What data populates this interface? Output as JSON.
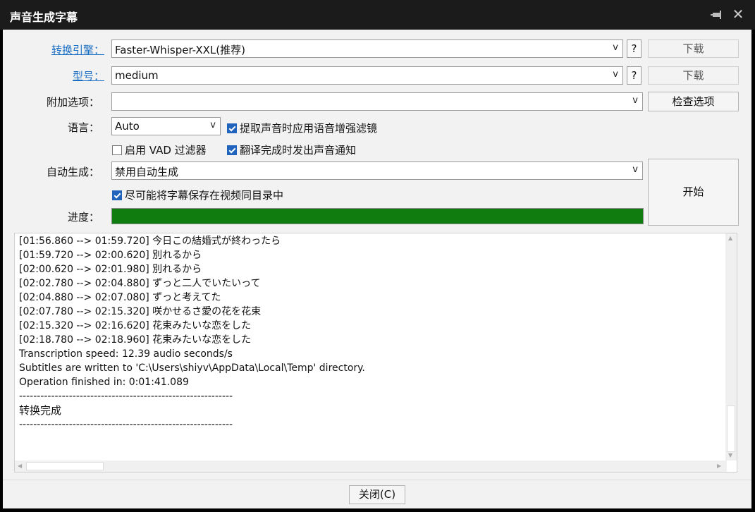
{
  "window": {
    "title": "声音生成字幕",
    "close_icon": "close-icon",
    "pin_icon": "pin-icon"
  },
  "form": {
    "engine": {
      "label": "转换引擎：",
      "value": "Faster-Whisper-XXL(推荐)",
      "help": "?",
      "download": "下载"
    },
    "model": {
      "label": "型号：",
      "value": "medium",
      "help": "?",
      "download": "下载"
    },
    "extra": {
      "label": "附加选项：",
      "value": "",
      "check_button": "检查选项"
    },
    "language": {
      "label": "语言：",
      "value": "Auto"
    },
    "enhance_filter": {
      "label": "提取声音时应用语音增强滤镜",
      "checked": true
    },
    "vad_filter": {
      "label": "启用 VAD 过滤器",
      "checked": false
    },
    "notify_sound": {
      "label": "翻译完成时发出声音通知",
      "checked": true
    },
    "auto_generate": {
      "label": "自动生成：",
      "value": "禁用自动生成"
    },
    "save_same_dir": {
      "label": "尽可能将字幕保存在视频同目录中",
      "checked": true
    },
    "progress": {
      "label": "进度：",
      "percent": 100
    },
    "start_button": "开始"
  },
  "log": [
    "[01:56.860 --> 01:59.720] 今日この結婚式が終わったら",
    "[01:59.720 --> 02:00.620] 別れるから",
    "[02:00.620 --> 02:01.980] 別れるから",
    "[02:02.780 --> 02:04.880] ずっと二人でいたいって",
    "[02:04.880 --> 02:07.080] ずっと考えてた",
    "[02:07.780 --> 02:15.320] 咲かせるさ愛の花を花束",
    "[02:15.320 --> 02:16.620] 花束みたいな恋をした",
    "[02:18.780 --> 02:18.960] 花束みたいな恋をした",
    "Transcription speed: 12.39 audio seconds/s",
    "Subtitles are written to 'C:\\Users\\shiyv\\AppData\\Local\\Temp' directory.",
    "Operation finished in: 0:01:41.089",
    "------------------------------------------------------------",
    "转换完成",
    "------------------------------------------------------------"
  ],
  "footer": {
    "close_button": "关闭(C)"
  }
}
